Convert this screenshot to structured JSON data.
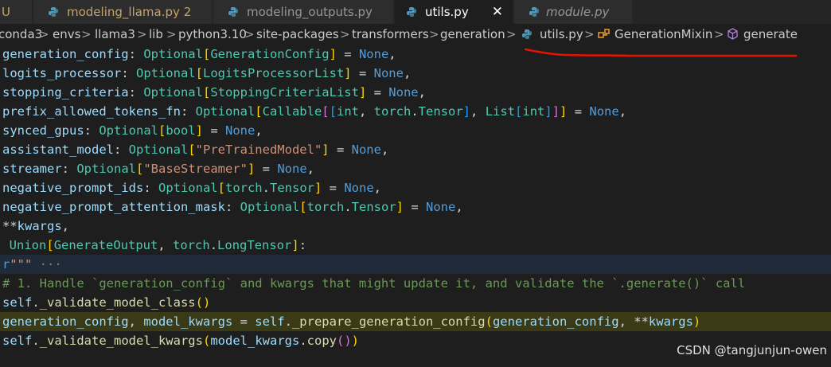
{
  "tabs": [
    {
      "label": "modeling_llama.py",
      "modified": "2",
      "active": false
    },
    {
      "label": "modeling_outputs.py",
      "active": false
    },
    {
      "label": "utils.py",
      "active": true,
      "close": "✕"
    },
    {
      "label": "module.py",
      "active": false
    }
  ],
  "breadcrumb": [
    "conda3",
    "envs",
    "llama3",
    "lib",
    "python3.10",
    "site-packages",
    "transformers",
    "generation",
    "utils.py",
    "GenerationMixin",
    "generate"
  ],
  "breadcrumb_separator": ">",
  "code_lines": [
    "generation_config: Optional[GenerationConfig] = None,",
    "logits_processor: Optional[LogitsProcessorList] = None,",
    "stopping_criteria: Optional[StoppingCriteriaList] = None,",
    "prefix_allowed_tokens_fn: Optional[Callable[[int, torch.Tensor], List[int]]] = None,",
    "synced_gpus: Optional[bool] = None,",
    "assistant_model: Optional[\"PreTrainedModel\"] = None,",
    "streamer: Optional[\"BaseStreamer\"] = None,",
    "negative_prompt_ids: Optional[torch.Tensor] = None,",
    "negative_prompt_attention_mask: Optional[torch.Tensor] = None,",
    "**kwargs,",
    "Union[GenerateOutput, torch.LongTensor]:",
    "r\"\"\" ···",
    "# 1. Handle `generation_config` and kwargs that might update it, and validate the `.generate()` call",
    "self._validate_model_class()",
    "generation_config, model_kwargs = self._prepare_generation_config(generation_config, **kwargs)",
    "self._validate_model_kwargs(model_kwargs.copy())"
  ],
  "watermark": "CSDN @tangjunjun-owen",
  "colors": {
    "editor_bg": "#1e1e1e",
    "current_line": "#3b3a17",
    "annotation_red": "#e51400",
    "py_icon": "#519aba"
  }
}
